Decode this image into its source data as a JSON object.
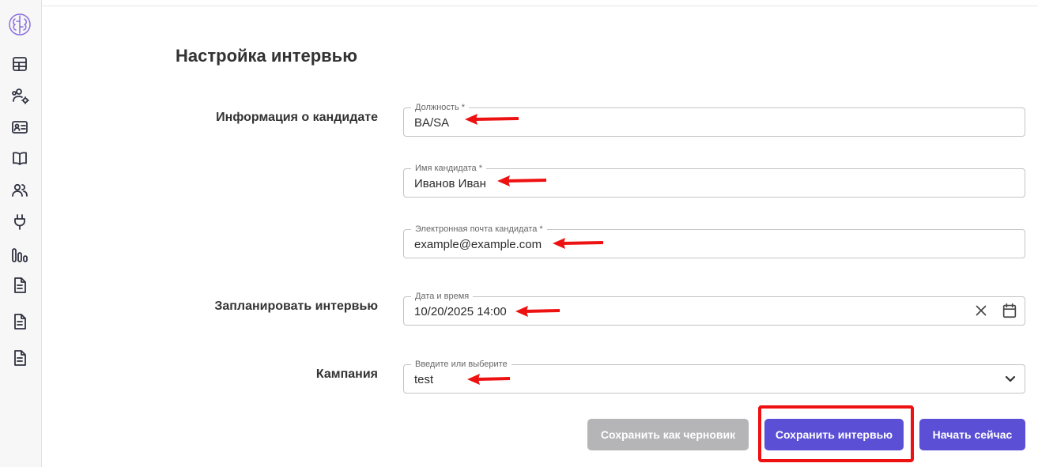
{
  "page": {
    "title": "Настройка интервью"
  },
  "sections": {
    "candidate_info": "Информация о кандидате",
    "schedule": "Запланировать интервью",
    "campaign": "Кампания"
  },
  "fields": {
    "position": {
      "label": "Должность",
      "required_mark": "*",
      "value": "BA/SA"
    },
    "candidate_name": {
      "label": "Имя кандидата",
      "required_mark": "*",
      "value": "Иванов Иван"
    },
    "candidate_email": {
      "label": "Электронная почта кандидата",
      "required_mark": "*",
      "value": "example@example.com"
    },
    "datetime": {
      "label": "Дата и время",
      "value": "10/20/2025 14:00"
    },
    "campaign": {
      "label": "Введите или выберите",
      "value": "test"
    }
  },
  "buttons": {
    "draft": "Сохранить как черновик",
    "save": "Сохранить интервью",
    "start": "Начать сейчас"
  },
  "sidebar": {
    "icons": [
      "brain-logo-icon",
      "table-icon",
      "users-settings-icon",
      "id-card-icon",
      "book-icon",
      "team-icon",
      "plug-icon",
      "bar-chart-icon",
      "document-icon",
      "document-icon",
      "document-icon"
    ]
  },
  "colors": {
    "primary": "#5b4fd5",
    "disabled": "#b5b5b8",
    "annotation": "#ee1111",
    "logo": "#8a6fe0"
  }
}
